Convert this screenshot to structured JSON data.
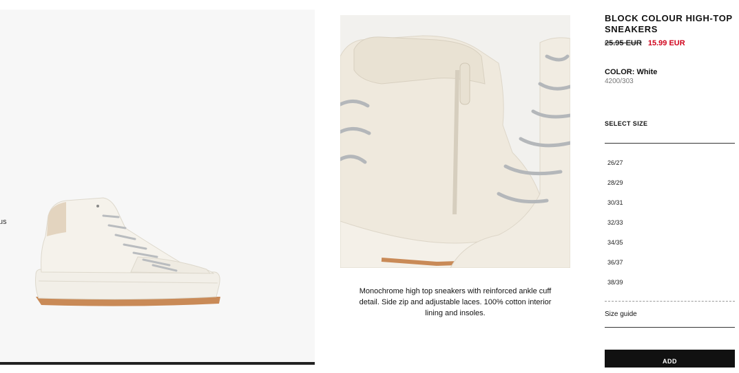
{
  "left_edge_text": "us",
  "description": {
    "text": "Monochrome high top sneakers with reinforced ankle cuff detail. Side zip and adjustable laces. 100% cotton interior lining and insoles."
  },
  "product": {
    "title": "BLOCK COLOUR HIGH-TOP SNEAKERS",
    "old_price": "25.95 EUR",
    "new_price": "15.99 EUR",
    "color_label": "COLOR:",
    "color_value": "White",
    "reference": "4200/303",
    "select_size_label": "SELECT SIZE",
    "sizes": [
      "26/27",
      "28/29",
      "30/31",
      "32/33",
      "34/35",
      "36/37",
      "38/39"
    ],
    "size_guide_label": "Size guide",
    "add_button_label": "ADD"
  },
  "colors": {
    "sale_price": "#d0021b",
    "button_bg": "#111111",
    "sneaker": "#efebe3"
  }
}
